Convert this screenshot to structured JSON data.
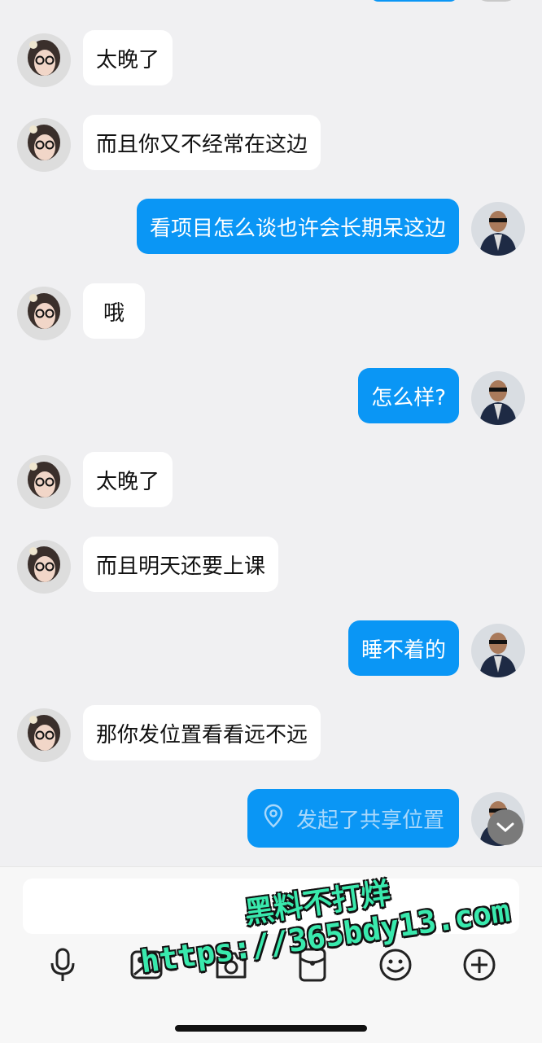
{
  "messages": [
    {
      "side": "left",
      "text": "太晚了"
    },
    {
      "side": "left",
      "text": "而且你又不经常在这边"
    },
    {
      "side": "right",
      "text": "看项目怎么谈也许会长期呆这边"
    },
    {
      "side": "left",
      "text": "哦"
    },
    {
      "side": "right",
      "text": "怎么样?"
    },
    {
      "side": "left",
      "text": "太晚了"
    },
    {
      "side": "left",
      "text": "而且明天还要上课"
    },
    {
      "side": "right",
      "text": "睡不着的"
    },
    {
      "side": "left",
      "text": "那你发位置看看远不远"
    },
    {
      "side": "right",
      "text": "发起了共享位置",
      "type": "location"
    }
  ],
  "composer": {
    "placeholder": ""
  },
  "toolbar": [
    "microphone-icon",
    "image-icon",
    "camera-icon",
    "red-packet-icon",
    "emoji-icon",
    "plus-icon"
  ],
  "watermark": {
    "line1": "黑料不打烊",
    "line2": "https://365bdy13.com"
  },
  "colors": {
    "accent": "#0a96f5",
    "background": "#f0f0f2",
    "watermark": "#39e9ad"
  }
}
